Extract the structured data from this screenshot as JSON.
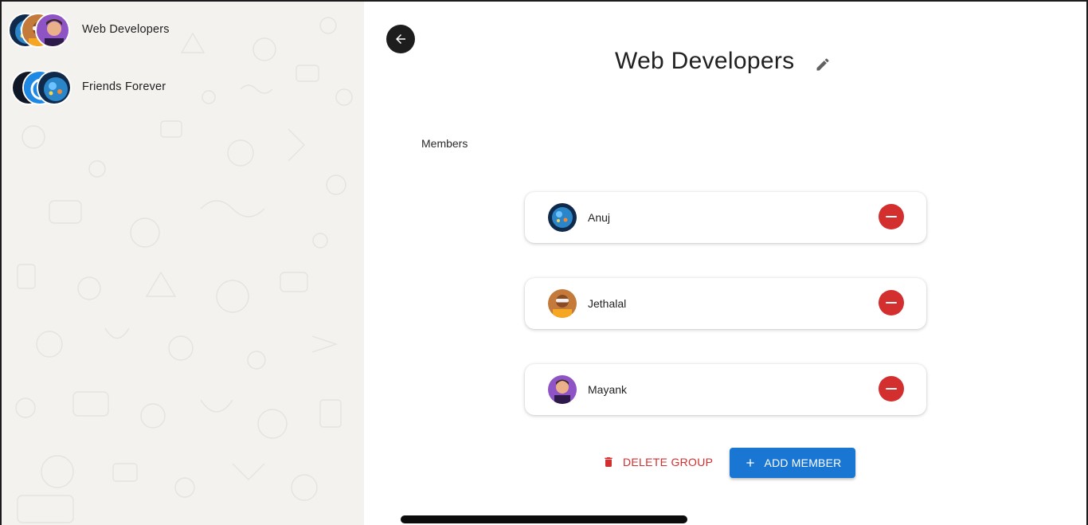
{
  "sidebar": {
    "groups": [
      {
        "label": "Web Developers",
        "avatars": [
          "avatar-blue-orb",
          "avatar-jethalal",
          "avatar-mayank"
        ]
      },
      {
        "label": "Friends Forever",
        "avatars": [
          "avatar-dark",
          "avatar-blue-app",
          "avatar-blue-orb"
        ]
      }
    ]
  },
  "main": {
    "back_icon": "arrow-left-icon",
    "title": "Web Developers",
    "edit_icon": "pencil-icon",
    "members_heading": "Members",
    "members": [
      {
        "name": "Anuj",
        "avatar": "avatar-blue-orb"
      },
      {
        "name": "Jethalal",
        "avatar": "avatar-jethalal"
      },
      {
        "name": "Mayank",
        "avatar": "avatar-mayank"
      }
    ],
    "remove_icon": "minus-circle-icon",
    "delete_label": "DELETE GROUP",
    "add_label": "ADD MEMBER"
  },
  "colors": {
    "danger": "#d32f2f",
    "primary": "#1976d2",
    "sidebar_bg": "#f4f2ef"
  }
}
